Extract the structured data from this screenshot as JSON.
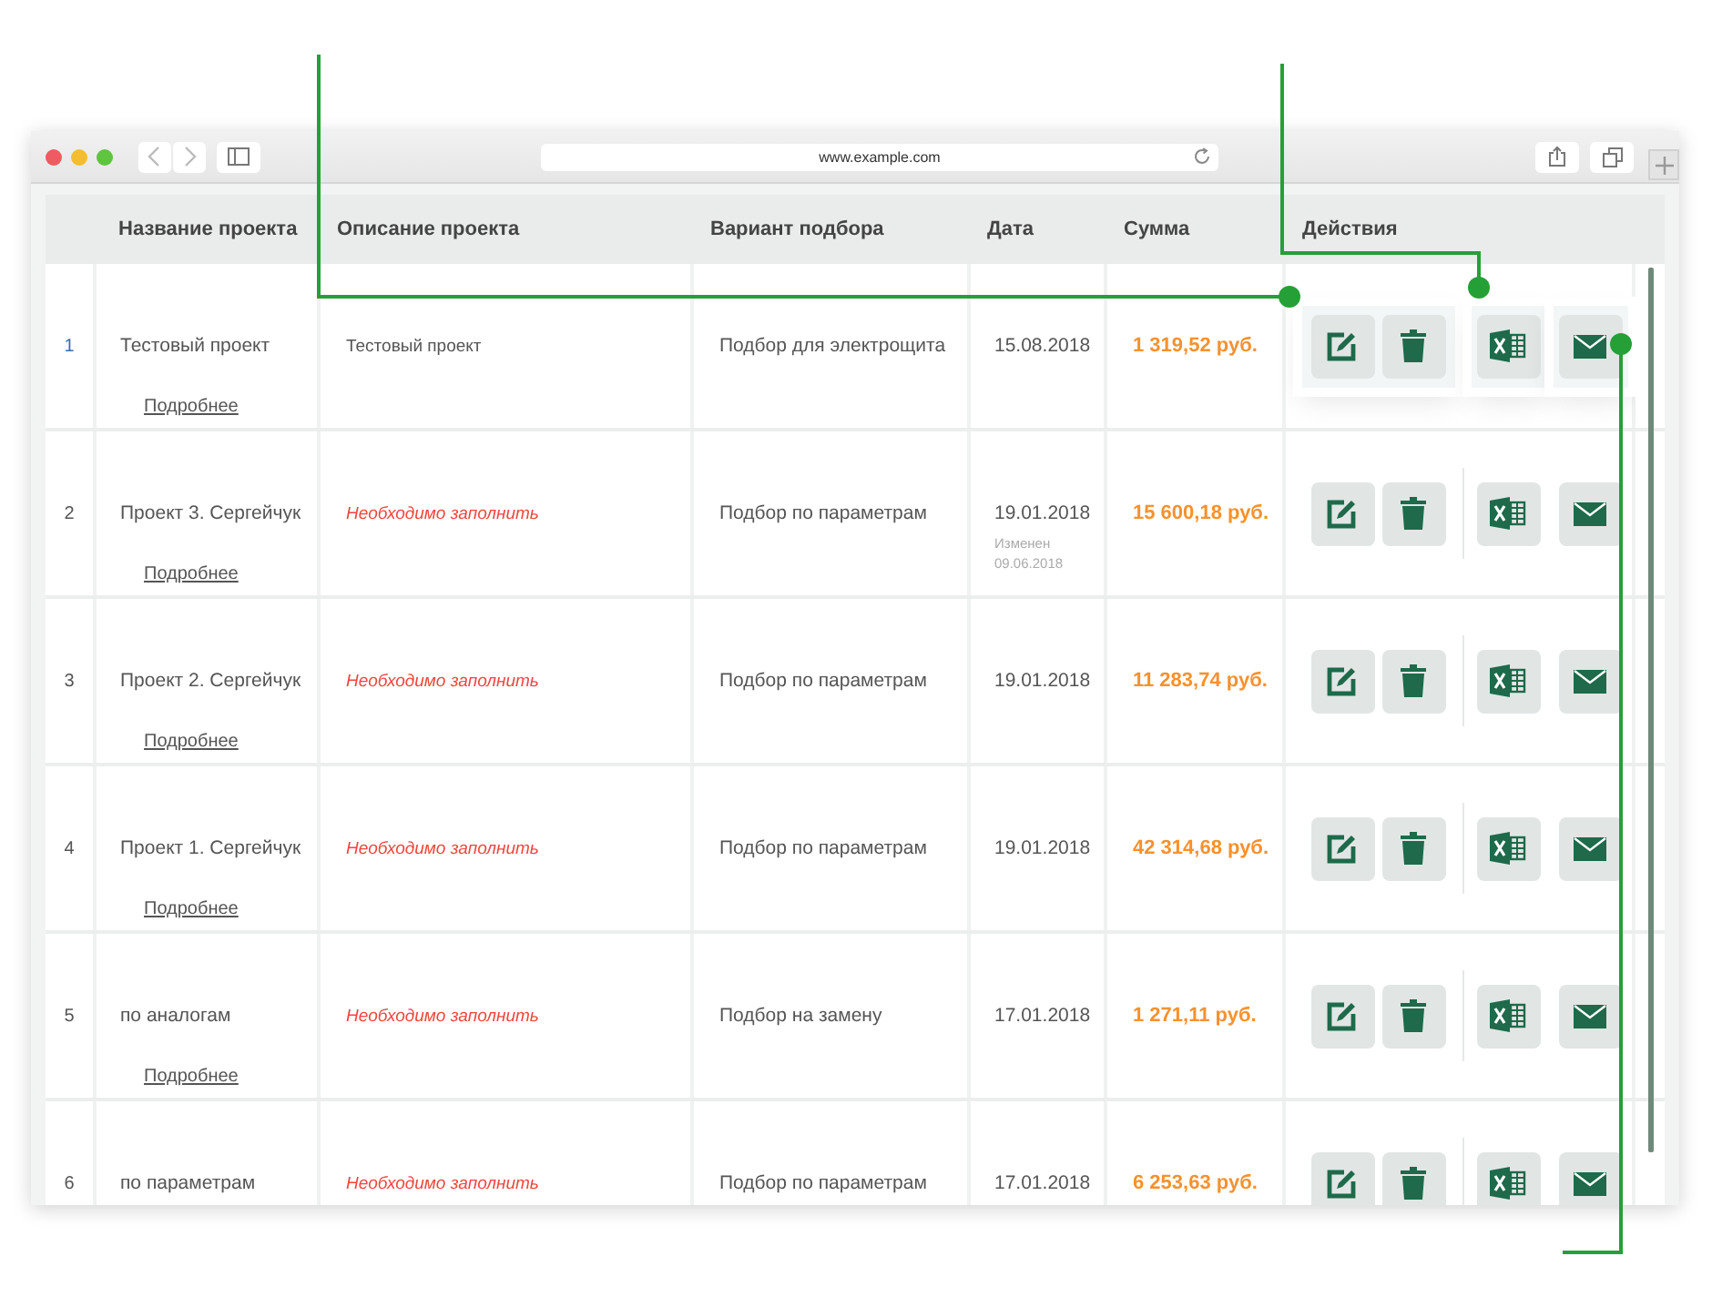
{
  "browser": {
    "url": "www.example.com"
  },
  "table": {
    "columns": [
      "Название проекта",
      "Описание проекта",
      "Вариант подбора",
      "Дата",
      "Сумма",
      "Действия"
    ],
    "rows": [
      {
        "number": "1",
        "name": "Тестовый проект",
        "link": "Подробнее",
        "description": {
          "text": "Тестовый проект",
          "missing": false
        },
        "variant": "Подбор для электрощита",
        "date": "15.08.2018",
        "sum": "1 319,52 руб.",
        "highlighted": true
      },
      {
        "number": "2",
        "name": "Проект 3. Сергейчук",
        "link": "Подробнее",
        "description": {
          "text": "Необходимо заполнить",
          "missing": true
        },
        "variant": "Подбор по параметрам",
        "date": "19.01.2018",
        "modified": "Изменен 09.06.2018",
        "sum": "15 600,18 руб.",
        "highlighted": false
      },
      {
        "number": "3",
        "name": "Проект 2. Сергейчук",
        "link": "Подробнее",
        "description": {
          "text": "Необходимо заполнить",
          "missing": true
        },
        "variant": "Подбор по параметрам",
        "date": "19.01.2018",
        "sum": "11 283,74 руб.",
        "highlighted": false
      },
      {
        "number": "4",
        "name": "Проект 1. Сергейчук",
        "link": "Подробнее",
        "description": {
          "text": "Необходимо заполнить",
          "missing": true
        },
        "variant": "Подбор по параметрам",
        "date": "19.01.2018",
        "sum": "42 314,68 руб.",
        "highlighted": false
      },
      {
        "number": "5",
        "name": "по аналогам",
        "link": "Подробнее",
        "description": {
          "text": "Необходимо заполнить",
          "missing": true
        },
        "variant": "Подбор на замену",
        "date": "17.01.2018",
        "sum": "1 271,11 руб.",
        "highlighted": false
      },
      {
        "number": "6",
        "name": "по параметрам",
        "description": {
          "text": "Необходимо заполнить",
          "missing": true
        },
        "variant": "Подбор по параметрам",
        "date": "17.01.2018",
        "sum": "6 253,63 руб.",
        "highlighted": false
      }
    ]
  }
}
